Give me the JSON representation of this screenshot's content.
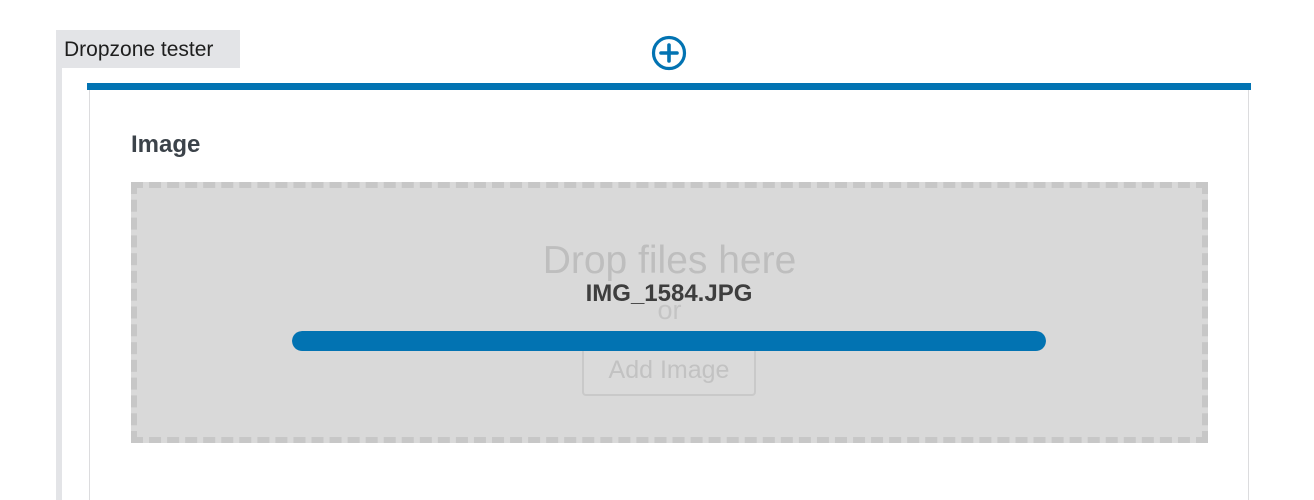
{
  "block": {
    "label": "Dropzone tester"
  },
  "toolbar": {
    "add_block_icon": "plus-circle-icon"
  },
  "field": {
    "label": "Image"
  },
  "dropzone": {
    "drop_text": "Drop files here",
    "or_text": "or",
    "add_button_label": "Add Image"
  },
  "upload": {
    "file_name": "IMG_1584.JPG",
    "progress": 1.0
  },
  "colors": {
    "accent": "#0273b2",
    "dropzone_bg": "#d9d9d9",
    "label_bg": "#e3e4e7"
  }
}
